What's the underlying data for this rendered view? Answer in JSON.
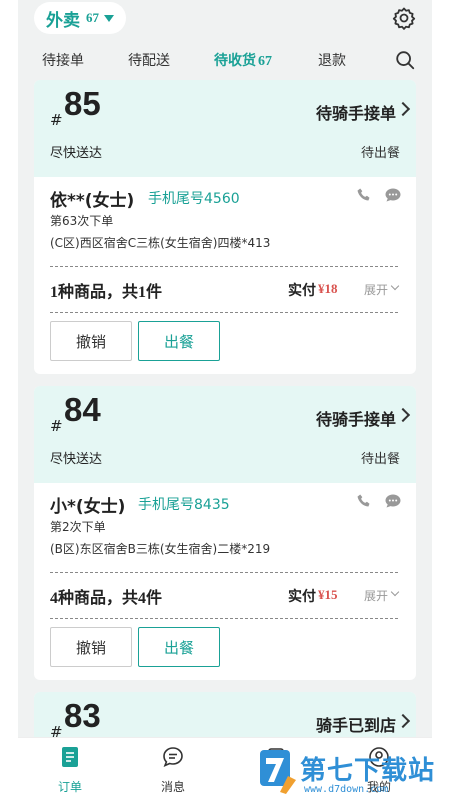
{
  "header": {
    "business_label": "外卖",
    "business_count": "67",
    "settings_icon": "gear-icon"
  },
  "tabs": [
    {
      "label": "待接单",
      "count": ""
    },
    {
      "label": "待配送",
      "count": ""
    },
    {
      "label": "待收货",
      "count": "67"
    },
    {
      "label": "退款",
      "count": ""
    }
  ],
  "search_icon": "search-icon",
  "orders": [
    {
      "hash": "#",
      "number": "85",
      "status": "待骑手接单",
      "ship_note": "尽快送达",
      "meal_status": "待出餐",
      "customer": "依**(女士)",
      "phone": "手机尾号4560",
      "times": "第63次下单",
      "address": "(C区)西区宿舍C三栋(女生宿舍)四楼*413",
      "goods": "1种商品，共1件",
      "paid_label": "实付",
      "price": "¥18",
      "expand": "展开",
      "cancel_label": "撤销",
      "serve_label": "出餐"
    },
    {
      "hash": "#",
      "number": "84",
      "status": "待骑手接单",
      "ship_note": "尽快送达",
      "meal_status": "待出餐",
      "customer": "小*(女士)",
      "phone": "手机尾号8435",
      "times": "第2次下单",
      "address": "(B区)东区宿舍B三栋(女生宿舍)二楼*219",
      "goods": "4种商品，共4件",
      "paid_label": "实付",
      "price": "¥15",
      "expand": "展开",
      "cancel_label": "撤销",
      "serve_label": "出餐"
    },
    {
      "hash": "#",
      "number": "83",
      "status": "骑手已到店"
    }
  ],
  "bottom_nav": [
    {
      "label": "订单",
      "icon": "order-icon",
      "active": true
    },
    {
      "label": "消息",
      "icon": "message-icon",
      "active": false
    },
    {
      "label": "",
      "icon": "store-icon",
      "active": false
    },
    {
      "label": "我的",
      "icon": "profile-icon",
      "active": false
    }
  ],
  "watermark": {
    "title": "第七下载站",
    "url": "www.d7down.com"
  },
  "colors": {
    "accent": "#1aa196",
    "card_header": "#e5f7f4",
    "price": "#d9534f",
    "background": "#f0f2f2",
    "watermark": "#2f8fd6"
  }
}
